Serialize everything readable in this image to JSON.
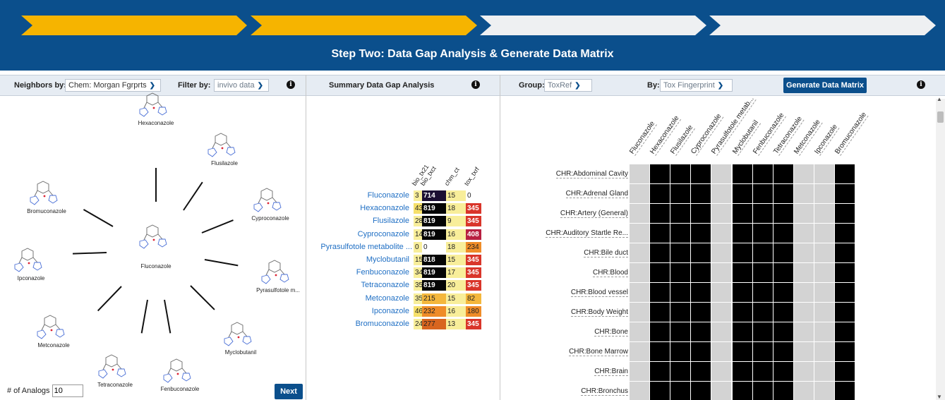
{
  "banner": {
    "title": "Step Two: Data Gap Analysis & Generate Data Matrix",
    "steps": [
      {
        "state": "done",
        "color": "#f6b400"
      },
      {
        "state": "current",
        "color": "#f6b400"
      },
      {
        "state": "todo",
        "color": "#eef0f2"
      },
      {
        "state": "todo",
        "color": "#eef0f2"
      }
    ]
  },
  "neighbors": {
    "label": "Neighbors by:",
    "selected": "Chem: Morgan Fgrprts",
    "filter_label": "Filter by:",
    "filter_value": "invivo data",
    "analogs_label": "# of Analogs",
    "analogs_value": "10",
    "next_label": "Next",
    "center": "Fluconazole",
    "ring": [
      "Hexaconazole",
      "Flusilazole",
      "Cyproconazole",
      "Pyrasulfotole m...",
      "Myclobutanil",
      "Fenbuconazole",
      "Tetraconazole",
      "Metconazole",
      "Ipconazole",
      "Bromuconazole"
    ]
  },
  "summary": {
    "title": "Summary Data Gap Analysis",
    "columns": [
      "bio_tx21",
      "bio_txct",
      "chm_ct",
      "tox_txrf"
    ],
    "rows": [
      {
        "name": "Fluconazole",
        "values": [
          "3",
          "714",
          "15",
          "0"
        ]
      },
      {
        "name": "Hexaconazole",
        "values": [
          "43",
          "819",
          "18",
          "345"
        ]
      },
      {
        "name": "Flusilazole",
        "values": [
          "28",
          "819",
          "9",
          "345"
        ]
      },
      {
        "name": "Cyproconazole",
        "values": [
          "14",
          "819",
          "16",
          "408"
        ]
      },
      {
        "name": "Pyrasulfotole metabolite ...",
        "values": [
          "0",
          "0",
          "18",
          "234"
        ]
      },
      {
        "name": "Myclobutanil",
        "values": [
          "15",
          "818",
          "15",
          "345"
        ]
      },
      {
        "name": "Fenbuconazole",
        "values": [
          "34",
          "819",
          "17",
          "345"
        ]
      },
      {
        "name": "Tetraconazole",
        "values": [
          "35",
          "819",
          "20",
          "345"
        ]
      },
      {
        "name": "Metconazole",
        "values": [
          "35",
          "215",
          "15",
          "82"
        ]
      },
      {
        "name": "Ipconazole",
        "values": [
          "46",
          "232",
          "16",
          "180"
        ]
      },
      {
        "name": "Bromuconazole",
        "values": [
          "24",
          "277",
          "13",
          "345"
        ]
      }
    ],
    "colors": {
      "c_pale": "#f8ee9a",
      "c_yellow": "#f6e06a",
      "c_amber": "#f4b73c",
      "c_orange": "#ef8c28",
      "c_red": "#d9352a",
      "c_crimson": "#b82041",
      "c_dark": "#1b0f33",
      "c_black": "#050505",
      "c_empty": "#ffffff",
      "c_burnt": "#d8651f"
    }
  },
  "matrix": {
    "group_label": "Group:",
    "group_value": "ToxRef",
    "by_label": "By:",
    "by_value": "Tox Fingerprint",
    "generate_label": "Generate Data Matrix",
    "columns": [
      "Fluconazole",
      "Hexaconazole",
      "Flusilazole",
      "Cyproconazole",
      "Pyrasulfotole metab...",
      "Myclobutanil",
      "Fenbuconazole",
      "Tetraconazole",
      "Metconazole",
      "Ipconazole",
      "Bromuconazole"
    ],
    "column_filled": [
      false,
      true,
      true,
      true,
      false,
      true,
      true,
      true,
      false,
      false,
      true
    ],
    "rows": [
      "CHR:Abdominal Cavity",
      "CHR:Adrenal Gland",
      "CHR:Artery (General)",
      "CHR:Auditory Startle Re...",
      "CHR:Bile duct",
      "CHR:Blood",
      "CHR:Blood vessel",
      "CHR:Body Weight",
      "CHR:Bone",
      "CHR:Bone Marrow",
      "CHR:Brain",
      "CHR:Bronchus"
    ],
    "fill_color": "#000000",
    "empty_color": "#d3d3d3"
  }
}
